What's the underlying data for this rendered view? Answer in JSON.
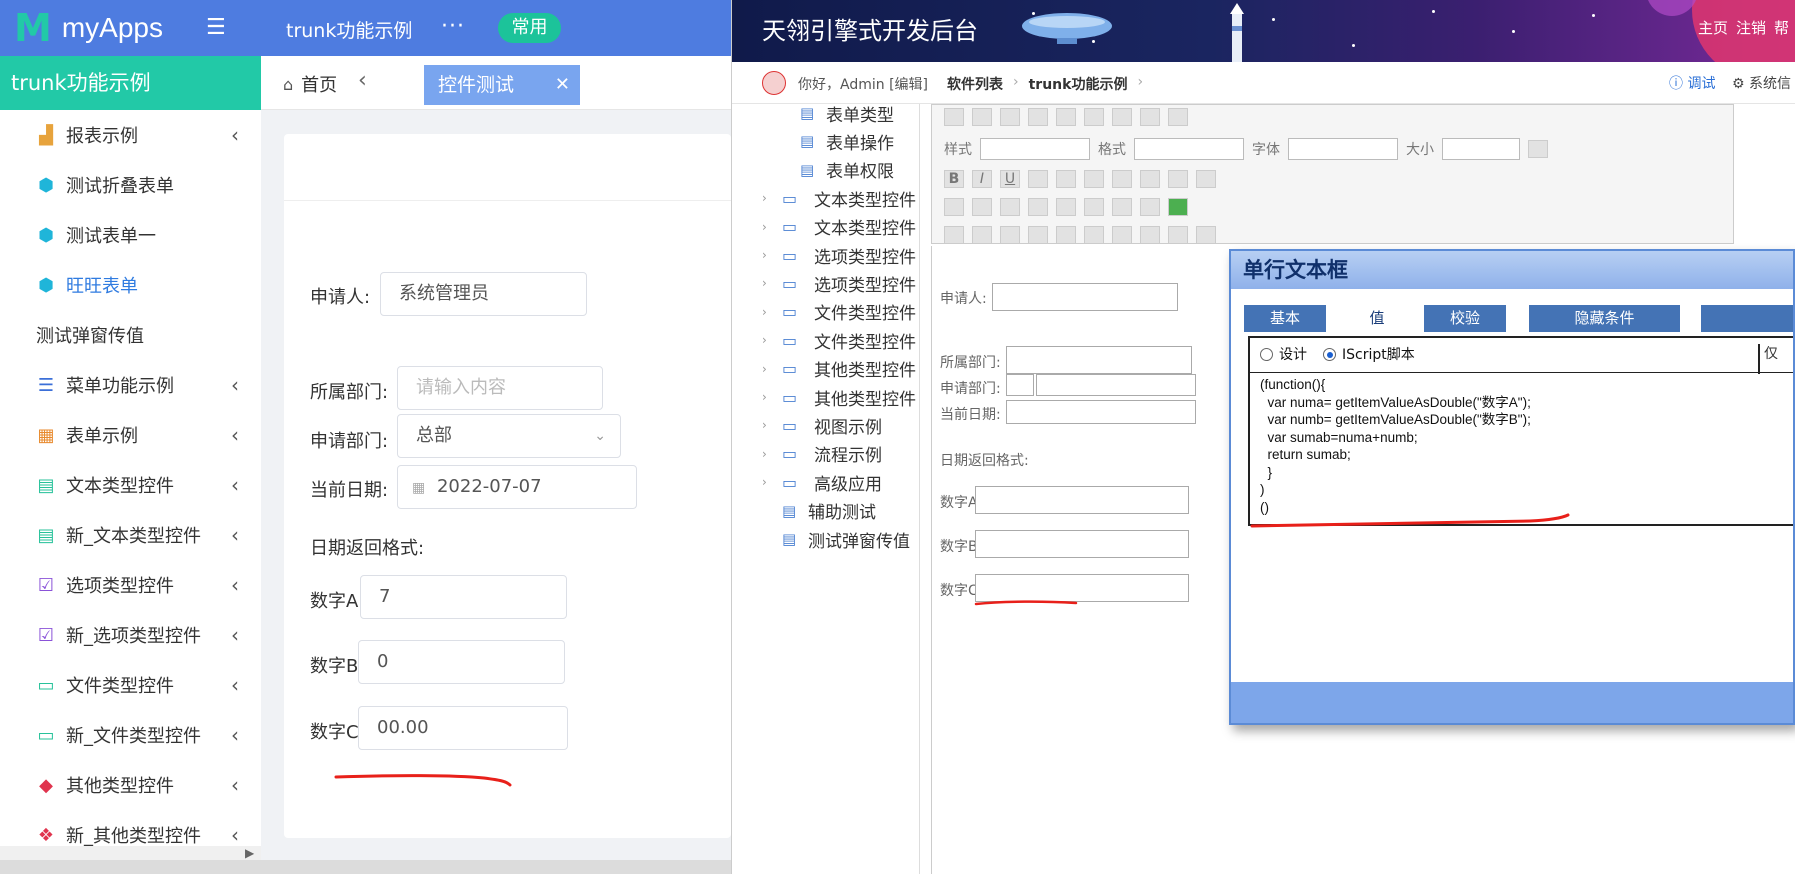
{
  "left": {
    "logo": {
      "mark": "M",
      "text": "myApps"
    },
    "header": {
      "app_title": "trunk功能示例",
      "more": "···",
      "badge": "常用"
    },
    "sidebar": {
      "title": "trunk功能示例",
      "items": [
        {
          "label": "报表示例",
          "icon": "chart-icon",
          "color": "#e7a33c",
          "chevron": true
        },
        {
          "label": "测试折叠表单",
          "icon": "cube-icon",
          "color": "#1fb5d9",
          "chevron": false
        },
        {
          "label": "测试表单一",
          "icon": "cube-icon",
          "color": "#1fb5d9",
          "chevron": false
        },
        {
          "label": "旺旺表单",
          "icon": "cube-icon",
          "color": "#1fb5d9",
          "chevron": false,
          "active": true
        },
        {
          "label": "测试弹窗传值",
          "icon": "",
          "color": "#333333",
          "chevron": false
        },
        {
          "label": "菜单功能示例",
          "icon": "list-icon",
          "color": "#3b6fd8",
          "chevron": true
        },
        {
          "label": "表单示例",
          "icon": "table-icon",
          "color": "#e88a2e",
          "chevron": true
        },
        {
          "label": "文本类型控件",
          "icon": "document-icon",
          "color": "#27c29a",
          "chevron": true
        },
        {
          "label": "新_文本类型控件",
          "icon": "document-icon",
          "color": "#27c29a",
          "chevron": true
        },
        {
          "label": "选项类型控件",
          "icon": "checkbox-icon",
          "color": "#8a52d8",
          "chevron": true
        },
        {
          "label": "新_选项类型控件",
          "icon": "checkbox-icon",
          "color": "#8a52d8",
          "chevron": true
        },
        {
          "label": "文件类型控件",
          "icon": "folder-icon",
          "color": "#27c29a",
          "chevron": true
        },
        {
          "label": "新_文件类型控件",
          "icon": "folder-icon",
          "color": "#27c29a",
          "chevron": true
        },
        {
          "label": "其他类型控件",
          "icon": "box-icon",
          "color": "#e0344e",
          "chevron": true
        },
        {
          "label": "新_其他类型控件",
          "icon": "boxes-icon",
          "color": "#e0344e",
          "chevron": true
        }
      ]
    },
    "tabs": {
      "home": "首页",
      "active": "控件测试",
      "close": "✕"
    },
    "form": {
      "applicant": {
        "label": "申请人:",
        "value": "系统管理员"
      },
      "dept": {
        "label": "所属部门:",
        "placeholder": "请输入内容"
      },
      "apply_dept": {
        "label": "申请部门:",
        "value": "总部"
      },
      "date": {
        "label": "当前日期:",
        "value": "2022-07-07"
      },
      "date_format": {
        "label": "日期返回格式:"
      },
      "num_a": {
        "label": "数字A",
        "value": "7"
      },
      "num_b": {
        "label": "数字B",
        "value": "0"
      },
      "num_c": {
        "label": "数字C",
        "value": "00.00"
      }
    }
  },
  "right": {
    "banner": {
      "title": "天翎引擎式开发后台",
      "links": [
        "主页",
        "注销",
        "帮"
      ]
    },
    "subbar": {
      "greeting": "你好，Admin [编辑]",
      "crumbs": [
        "软件列表",
        "trunk功能示例"
      ],
      "debug": "调试",
      "system": "系统信"
    },
    "tree": [
      {
        "label": "表单类型",
        "kind": "doc",
        "indent": 2
      },
      {
        "label": "表单操作",
        "kind": "doc",
        "indent": 2
      },
      {
        "label": "表单权限",
        "kind": "doc",
        "indent": 2
      },
      {
        "label": "文本类型控件",
        "kind": "folder",
        "indent": 1
      },
      {
        "label": "文本类型控件",
        "kind": "folder",
        "indent": 1
      },
      {
        "label": "选项类型控件",
        "kind": "folder",
        "indent": 1
      },
      {
        "label": "选项类型控件",
        "kind": "folder",
        "indent": 1
      },
      {
        "label": "文件类型控件",
        "kind": "folder",
        "indent": 1
      },
      {
        "label": "文件类型控件",
        "kind": "folder",
        "indent": 1
      },
      {
        "label": "其他类型控件",
        "kind": "folder",
        "indent": 1
      },
      {
        "label": "其他类型控件",
        "kind": "folder",
        "indent": 1
      },
      {
        "label": "视图示例",
        "kind": "folder",
        "indent": 1
      },
      {
        "label": "流程示例",
        "kind": "folder",
        "indent": 1
      },
      {
        "label": "高级应用",
        "kind": "folder",
        "indent": 1
      },
      {
        "label": "辅助测试",
        "kind": "doc",
        "indent": 1
      },
      {
        "label": "测试弹窗传值",
        "kind": "doc",
        "indent": 1
      }
    ],
    "toolbar": {
      "style": "样式",
      "format": "格式",
      "font": "字体",
      "size": "大小"
    },
    "design": {
      "applicant": "申请人:",
      "dept": "所属部门:",
      "apply_dept": "申请部门:",
      "date": "当前日期:",
      "date_format": "日期返回格式:",
      "num_a": "数字A",
      "num_b": "数字B",
      "num_c": "数字C"
    },
    "dialog": {
      "title": "单行文本框",
      "tabs": [
        "基本",
        "值",
        "校验",
        "隐藏条件",
        ""
      ],
      "radio_design": "设计",
      "radio_script": "IScript脚本",
      "only": "仅",
      "code": "(function(){\n  var numa= getItemValueAsDouble(\"数字A\");\n  var numb= getItemValueAsDouble(\"数字B\");\n  var sumab=numa+numb;\n  return sumab;\n  }\n)\n()"
    }
  },
  "annotation_color": "#e8201a"
}
